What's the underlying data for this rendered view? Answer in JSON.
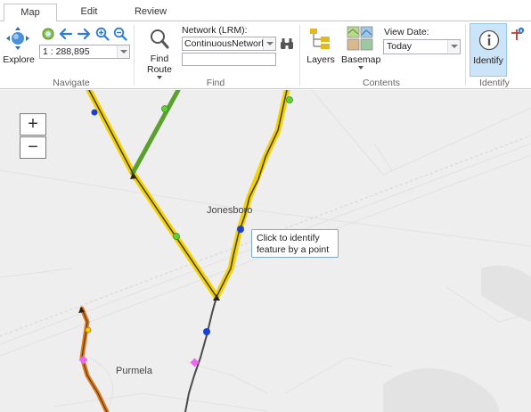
{
  "tabs": [
    {
      "label": "Map",
      "active": true
    },
    {
      "label": "Edit",
      "active": false
    },
    {
      "label": "Review",
      "active": false
    }
  ],
  "ribbon": {
    "navigate": {
      "explore_label": "Explore",
      "scale_value": "1 : 288,895",
      "group_label": "Navigate"
    },
    "find": {
      "find_route_label_1": "Find",
      "find_route_label_2": "Route",
      "network_label": "Network (LRM):",
      "network_value": "ContinuousNetwork",
      "network_search_value": "",
      "group_label": "Find"
    },
    "contents": {
      "layers_label": "Layers",
      "basemap_label": "Basemap",
      "view_date_label": "View Date:",
      "view_date_value": "Today",
      "group_label": "Contents"
    },
    "identify": {
      "identify_label": "Identify",
      "group_label": "Identify"
    }
  },
  "map": {
    "zoom_in": "+",
    "zoom_out": "−",
    "places": [
      "Jonesboro",
      "Purmela"
    ],
    "tooltip": "Click to identify feature by a point",
    "colors": {
      "background": "#eeeeee",
      "route_highlight": "#f5d100",
      "route_green": "#5aa02c",
      "route_orange": "#e07a1f",
      "route_line": "#444444",
      "event_blue": "#1a3fd6",
      "event_green": "#5fd23a",
      "event_pink": "#ee66ee",
      "accent": "#cce4f7"
    }
  }
}
